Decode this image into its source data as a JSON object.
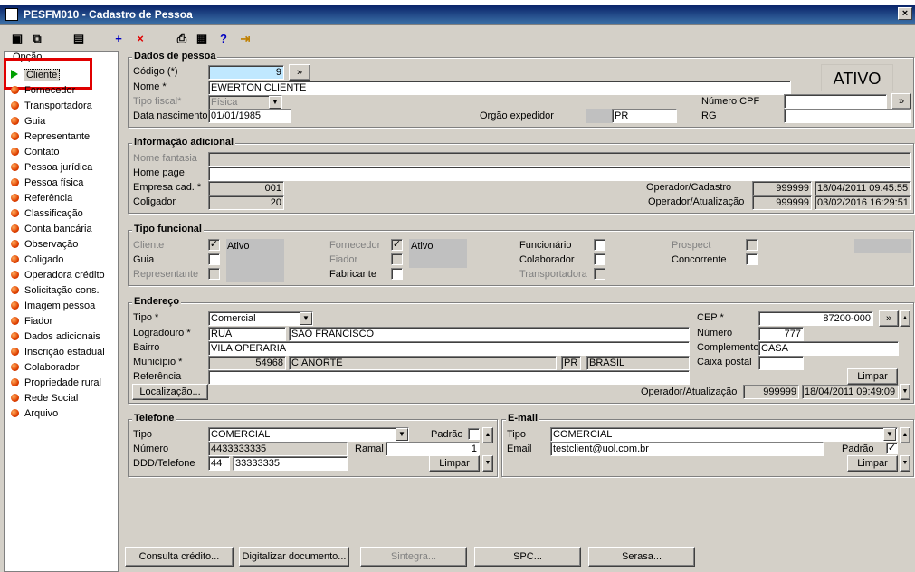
{
  "window": {
    "title": "PESFM010 - Cadastro de Pessoa",
    "close": "×"
  },
  "toolbar": {
    "icons": [
      "select-icon",
      "copy-icon",
      "save-icon",
      "add-icon",
      "delete-icon",
      "print-icon",
      "grid-icon",
      "help-icon",
      "exit-icon"
    ],
    "add": "+",
    "delete": "×",
    "help": "?"
  },
  "sidebar": {
    "header": "Opção",
    "selected": "Cliente",
    "items": [
      "Fornecedor",
      "Transportadora",
      "Guia",
      "Representante",
      "Contato",
      "Pessoa jurídica",
      "Pessoa física",
      "Referência",
      "Classificação",
      "Conta bancária",
      "Observação",
      "Coligado",
      "Operadora crédito",
      "Solicitação cons.",
      "Imagem pessoa",
      "Fiador",
      "Dados adicionais",
      "Inscrição estadual",
      "Colaborador",
      "Propriedade rural",
      "Rede Social",
      "Arquivo"
    ]
  },
  "dados": {
    "title": "Dados de pessoa",
    "codigo_label": "Código (*)",
    "codigo_value": "9",
    "codigo_btn": "»",
    "nome_label": "Nome *",
    "nome_value": "EWERTON CLIENTE",
    "status": "ATIVO",
    "tipo_fiscal_label": "Tipo fiscal*",
    "tipo_fiscal_value": "Física",
    "cpf_label": "Número CPF",
    "cpf_value": "",
    "cpf_btn": "»",
    "nasc_label": "Data nascimento",
    "nasc_value": "01/01/1985",
    "orgao_label": "Orgão expedidor",
    "orgao_value": "PR",
    "rg_label": "RG",
    "rg_value": ""
  },
  "info": {
    "title": "Informação adicional",
    "fantasia_label": "Nome fantasia",
    "fantasia_value": "",
    "homepage_label": "Home page",
    "homepage_value": "",
    "empresa_label": "Empresa cad. *",
    "empresa_value": "001",
    "coligador_label": "Coligador",
    "coligador_value": "20",
    "op_cad_label": "Operador/Cadastro",
    "op_cad_value": "999999",
    "op_cad_date": "18/04/2011 09:45:55",
    "op_atu_label": "Operador/Atualização",
    "op_atu_value": "999999",
    "op_atu_date": "03/02/2016 16:29:51"
  },
  "tipo": {
    "title": "Tipo funcional",
    "cliente": "Cliente",
    "guia": "Guia",
    "representante": "Representante",
    "ativo1": "Ativo",
    "fornecedor": "Fornecedor",
    "fiador": "Fiador",
    "fabricante": "Fabricante",
    "ativo2": "Ativo",
    "funcionario": "Funcionário",
    "colaborador": "Colaborador",
    "transportadora": "Transportadora",
    "prospect": "Prospect",
    "concorrente": "Concorrente",
    "check": "✓"
  },
  "endereco": {
    "title": "Endereço",
    "tipo_label": "Tipo *",
    "tipo_value": "Comercial",
    "logr_label": "Logradouro *",
    "logr_tipo": "RUA",
    "logr_value": "SAO FRANCISCO",
    "bairro_label": "Bairro",
    "bairro_value": "VILA OPERARIA",
    "mun_label": "Município *",
    "mun_code": "54968",
    "mun_name": "CIANORTE",
    "mun_uf": "PR",
    "mun_pais": "BRASIL",
    "ref_label": "Referência",
    "ref_value": "",
    "cep_label": "CEP *",
    "cep_value": "87200-000",
    "cep_btn": "»",
    "numero_label": "Número",
    "numero_value": "777",
    "compl_label": "Complemento",
    "compl_value": "CASA",
    "caixa_label": "Caixa postal",
    "caixa_value": "",
    "limpar": "Limpar",
    "localizacao": "Localização...",
    "op_label": "Operador/Atualização",
    "op_value": "999999",
    "op_date": "18/04/2011 09:49:09"
  },
  "telefone": {
    "title": "Telefone",
    "tipo_label": "Tipo",
    "tipo_value": "COMERCIAL",
    "padrao_label": "Padrão",
    "numero_label": "Número",
    "numero_value": "4433333335",
    "ramal_label": "Ramal",
    "ramal_value": "1",
    "ddd_label": "DDD/Telefone",
    "ddd_value": "44",
    "fone_value": "33333335",
    "limpar": "Limpar"
  },
  "email": {
    "title": "E-mail",
    "tipo_label": "Tipo",
    "tipo_value": "COMERCIAL",
    "email_label": "Email",
    "email_value": "testclient@uol.com.br",
    "padrao_label": "Padrão",
    "padrao_check": "✓",
    "limpar": "Limpar"
  },
  "footer": {
    "consulta": "Consulta crédito...",
    "digitalizar": "Digitalizar documento...",
    "sintegra": "Sintegra...",
    "spc": "SPC...",
    "serasa": "Serasa..."
  }
}
